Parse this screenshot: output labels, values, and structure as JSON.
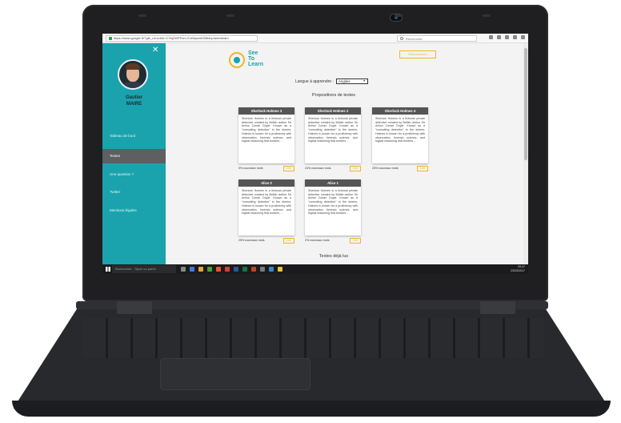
{
  "browser": {
    "url": "https://www.google.fr/?gfe_rd=cr&ei=CYkj2WPFom-S-bMpwnD2Mi#q=seetolearn",
    "search_placeholder": "Rechercher"
  },
  "sidebar": {
    "user_first": "Gautier",
    "user_last": "MAIRE",
    "items": [
      {
        "label": "Tableau de bord"
      },
      {
        "label": "Textes"
      },
      {
        "label": "Une question ?"
      },
      {
        "label": "Twitter"
      },
      {
        "label": "Mentions légales"
      }
    ]
  },
  "header": {
    "logo_line1": "See",
    "logo_line2": "To",
    "logo_line3": "Learn",
    "logout_label": "Déconnexion"
  },
  "lang": {
    "label": "Langue à apprendre :",
    "selected": "Anglais"
  },
  "proposals_title": "Propositions de textes",
  "read_title": "Textes déjà lus",
  "card_text": "Sherlock Holmes is a fictional private detective created by British author Sir Arthur Conan Doyle. Known as a \"consulting detective\" in the stories, Holmes is known for a proficiency with observation, forensic science, and logical reasoning that borders ...",
  "cards": [
    {
      "title": "Sherlock Holmes 3",
      "new_words": "0% nouveaux mots",
      "button": "Lire"
    },
    {
      "title": "Sherlock Holmes 2",
      "new_words": "24% nouveaux mots",
      "button": "Lire"
    },
    {
      "title": "Sherlock Holmes 4",
      "new_words": "25% nouveaux mots",
      "button": "Lire"
    },
    {
      "title": "Alice 2",
      "new_words": "25% nouveaux mots",
      "button": "Lire"
    },
    {
      "title": "Alice 1",
      "new_words": "2% nouveaux mots",
      "button": "Lire"
    }
  ],
  "taskbar": {
    "search_placeholder": "Rechercher - Taper ou parler",
    "time": "09:47",
    "date": "23/03/2017"
  },
  "colors": {
    "teal": "#1aa3ad",
    "accent": "#f4b429",
    "card_header": "#555555"
  }
}
